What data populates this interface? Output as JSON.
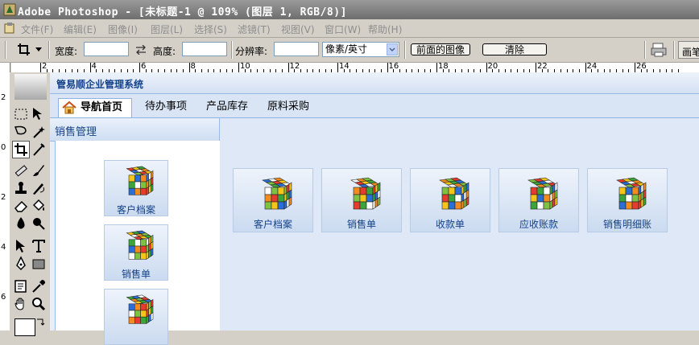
{
  "window": {
    "title": "Adobe Photoshop - [未标题-1 @ 109% (图层 1, RGB/8)]"
  },
  "menu": [
    {
      "label": "文件(F)"
    },
    {
      "label": "编辑(E)"
    },
    {
      "label": "图像(I)"
    },
    {
      "label": "图层(L)"
    },
    {
      "label": "选择(S)"
    },
    {
      "label": "滤镜(T)"
    },
    {
      "label": "视图(V)"
    },
    {
      "label": "窗口(W)"
    },
    {
      "label": "帮助(H)"
    }
  ],
  "options": {
    "width_label": "宽度:",
    "height_label": "高度:",
    "resolution_label": "分辨率:",
    "unit_value": "像素/英寸",
    "front_image_button": "前面的图像",
    "clear_button": "清除",
    "brush_label": "画笔"
  },
  "ruler": {
    "h_ticks": [
      "2",
      "4",
      "6",
      "8",
      "10",
      "12",
      "14",
      "16",
      "18",
      "20",
      "22",
      "24",
      "26"
    ],
    "v_ticks": [
      "2",
      "0",
      "2",
      "4",
      "6"
    ]
  },
  "app": {
    "title": "管易顺企业管理系统",
    "tabs": [
      {
        "label": "导航首页"
      },
      {
        "label": "待办事项"
      },
      {
        "label": "产品库存"
      },
      {
        "label": "原料采购"
      }
    ],
    "left_panel": {
      "title": "销售管理",
      "items": [
        {
          "label": "客户档案"
        },
        {
          "label": "销售单"
        },
        {
          "label": ""
        }
      ]
    },
    "main_shortcuts": [
      {
        "label": "客户档案"
      },
      {
        "label": "销售单"
      },
      {
        "label": "收款单"
      },
      {
        "label": "应收账款"
      },
      {
        "label": "销售明细账"
      }
    ]
  },
  "colors": {
    "accent": "#15428b",
    "panel_border": "#99bbe8",
    "app_bg": "#dfe8f6"
  }
}
